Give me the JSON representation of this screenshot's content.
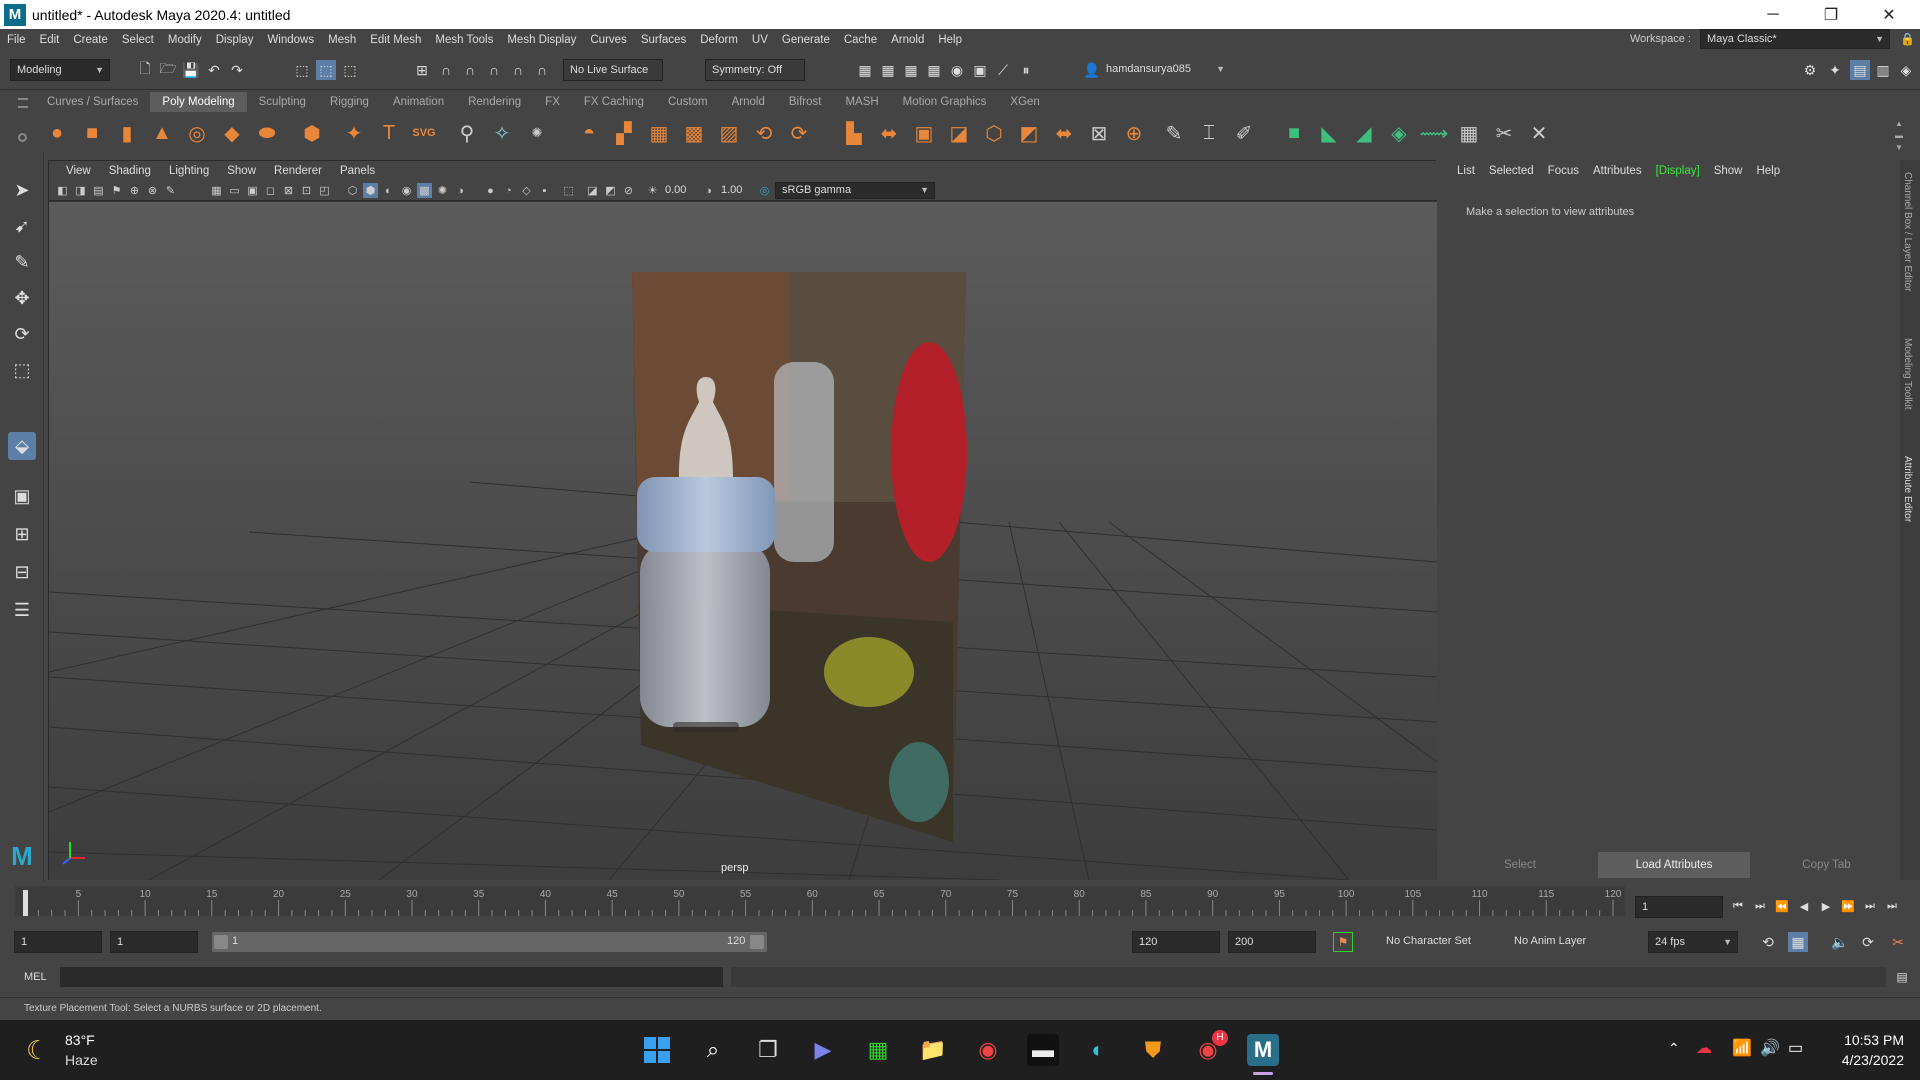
{
  "window": {
    "title": "untitled* - Autodesk Maya 2020.4: untitled",
    "controls": [
      "─",
      "❐",
      "✕"
    ]
  },
  "menubar": {
    "items": [
      "File",
      "Edit",
      "Create",
      "Select",
      "Modify",
      "Display",
      "Windows",
      "Mesh",
      "Edit Mesh",
      "Mesh Tools",
      "Mesh Display",
      "Curves",
      "Surfaces",
      "Deform",
      "UV",
      "Generate",
      "Cache",
      "Arnold",
      "Help"
    ],
    "workspace_label": "Workspace :",
    "workspace_value": "Maya Classic*"
  },
  "statusline": {
    "mode": "Modeling",
    "live_surface": "No Live Surface",
    "symmetry": "Symmetry: Off",
    "user": "hamdansurya085"
  },
  "shelf": {
    "tabs": [
      "Curves / Surfaces",
      "Poly Modeling",
      "Sculpting",
      "Rigging",
      "Animation",
      "Rendering",
      "FX",
      "FX Caching",
      "Custom",
      "Arnold",
      "Bifrost",
      "MASH",
      "Motion Graphics",
      "XGen"
    ],
    "active": "Poly Modeling",
    "icons": [
      "sphere-icon",
      "cube-icon",
      "cylinder-icon",
      "cone-icon",
      "torus-icon",
      "plane-icon",
      "disc-icon",
      "platonic-icon",
      "superellipse-icon",
      "text-icon",
      "svg-icon",
      "sweep-icon",
      "bevel-icon",
      "xyz-icon"
    ]
  },
  "viewport": {
    "menus": [
      "View",
      "Shading",
      "Lighting",
      "Show",
      "Renderer",
      "Panels"
    ],
    "exposure": "0.00",
    "gamma": "1.00",
    "color_space": "sRGB gamma",
    "camera_label": "persp"
  },
  "attribute_editor": {
    "menus": [
      "List",
      "Selected",
      "Focus",
      "Attributes",
      "[Display]",
      "Show",
      "Help"
    ],
    "message": "Make a selection to view attributes",
    "buttons": {
      "select": "Select",
      "load": "Load Attributes",
      "copy": "Copy Tab"
    }
  },
  "side_tabs": [
    "Channel Box / Layer Editor",
    "Modeling Toolkit",
    "Attribute Editor"
  ],
  "timeline": {
    "ticks": [
      "5",
      "10",
      "15",
      "20",
      "25",
      "30",
      "35",
      "40",
      "45",
      "50",
      "55",
      "60",
      "65",
      "70",
      "75",
      "80",
      "85",
      "90",
      "95",
      "100",
      "105",
      "110",
      "115",
      "120"
    ],
    "current_frame": "1"
  },
  "range": {
    "start": "1",
    "playback_start": "1",
    "slider_start": "1",
    "slider_end": "120",
    "playback_end": "120",
    "end": "200",
    "character_set": "No Character Set",
    "anim_layer": "No Anim Layer",
    "fps": "24 fps"
  },
  "command": {
    "label": "MEL"
  },
  "help_line": "Texture Placement Tool: Select a NURBS surface or 2D placement.",
  "taskbar": {
    "weather_temp": "83°F",
    "weather_desc": "Haze",
    "time": "10:53 PM",
    "date": "4/23/2022",
    "chrome_badge": "H"
  }
}
